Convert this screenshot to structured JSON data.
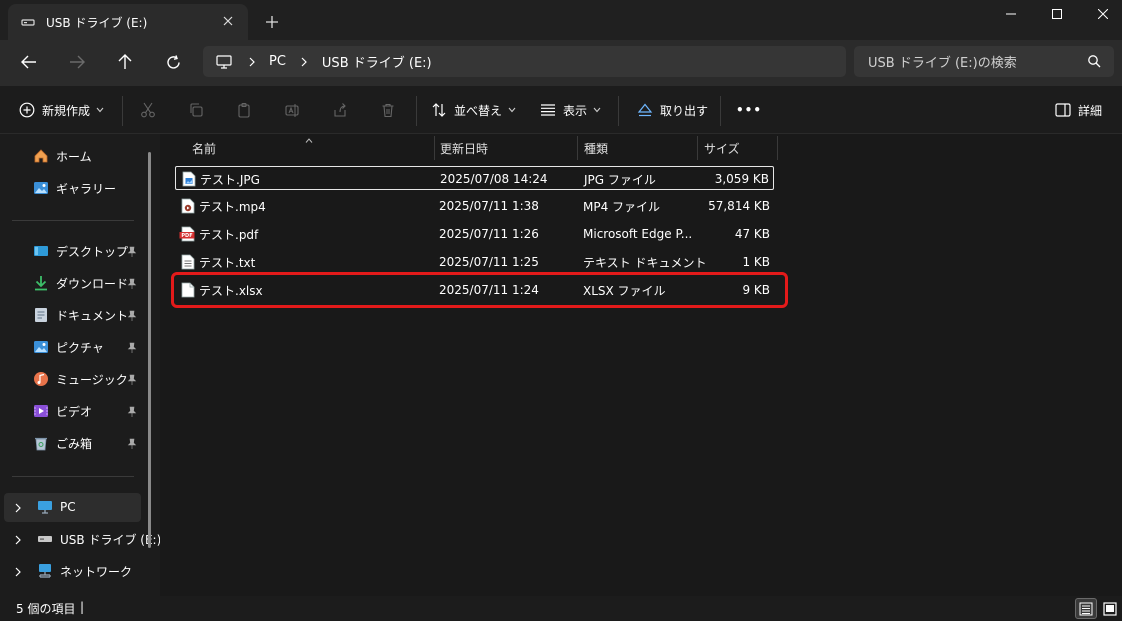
{
  "tab": {
    "title": "USB ドライブ (E:)",
    "new_tab": "+"
  },
  "window": {
    "minimize": "—",
    "maximize": "☐",
    "close": "✕"
  },
  "address": {
    "crumbs": [
      "PC",
      "USB ドライブ (E:)"
    ]
  },
  "search": {
    "placeholder": "USB ドライブ (E:)の検索"
  },
  "toolbar": {
    "new_label": "新規作成",
    "sort_label": "並べ替え",
    "view_label": "表示",
    "eject_label": "取り出す",
    "more_label": "•••",
    "details_label": "詳細"
  },
  "sidebar": {
    "quick": [
      {
        "label": "ホーム"
      },
      {
        "label": "ギャラリー"
      }
    ],
    "pinned": [
      {
        "label": "デスクトップ"
      },
      {
        "label": "ダウンロード"
      },
      {
        "label": "ドキュメント"
      },
      {
        "label": "ピクチャ"
      },
      {
        "label": "ミュージック"
      },
      {
        "label": "ビデオ"
      },
      {
        "label": "ごみ箱"
      }
    ],
    "drives": [
      {
        "label": "PC"
      },
      {
        "label": "USB ドライブ (E:)"
      },
      {
        "label": "ネットワーク"
      }
    ]
  },
  "columns": {
    "name": "名前",
    "date": "更新日時",
    "type": "種類",
    "size": "サイズ"
  },
  "files": [
    {
      "name": "テスト.JPG",
      "date": "2025/07/08 14:24",
      "type": "JPG ファイル",
      "size": "3,059 KB",
      "icon": "jpg-file-icon"
    },
    {
      "name": "テスト.mp4",
      "date": "2025/07/11 1:38",
      "type": "MP4 ファイル",
      "size": "57,814 KB",
      "icon": "mp4-file-icon"
    },
    {
      "name": "テスト.pdf",
      "date": "2025/07/11 1:26",
      "type": "Microsoft Edge P...",
      "size": "47 KB",
      "icon": "pdf-file-icon"
    },
    {
      "name": "テスト.txt",
      "date": "2025/07/11 1:25",
      "type": "テキスト ドキュメント",
      "size": "1 KB",
      "icon": "txt-file-icon"
    },
    {
      "name": "テスト.xlsx",
      "date": "2025/07/11 1:24",
      "type": "XLSX ファイル",
      "size": "9 KB",
      "icon": "xlsx-file-icon"
    }
  ],
  "status": {
    "count": "5 個の項目",
    "sep": "|"
  },
  "colors": {
    "highlight": "#e31a1a",
    "selection_border": "#ffffff",
    "pdf_red": "#d32f2f"
  }
}
